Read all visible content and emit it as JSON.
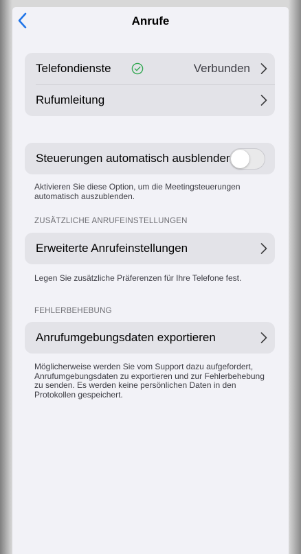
{
  "navbar": {
    "title": "Anrufe",
    "back_icon": "chevron-left-icon"
  },
  "phone_services": {
    "label": "Telefondienste",
    "status_icon": "check-circle-icon",
    "status": "Verbunden"
  },
  "call_forwarding": {
    "label": "Rufumleitung"
  },
  "auto_hide": {
    "label": "Steuerungen automatisch ausblenden",
    "enabled": false,
    "footnote": "Aktivieren Sie diese Option, um die Meetingsteuerungen automatisch auszublenden."
  },
  "additional_settings": {
    "header": "ZUSÄTZLICHE ANRUFEINSTELLUNGEN",
    "label": "Erweiterte Anrufeinstellungen",
    "footnote": "Legen Sie zusätzliche Präferenzen für Ihre Telefone fest."
  },
  "troubleshooting": {
    "header": "FEHLERBEHEBUNG",
    "label": "Anrufumgebungsdaten exportieren",
    "footnote": "Möglicherweise werden Sie vom Support dazu aufgefordert, Anrufumgebungsdaten zu exportieren und zur Fehlerbehebung zu senden. Es werden keine persönlichen Daten in den Protokollen gespeichert."
  },
  "colors": {
    "accent": "#1f74e8",
    "status_green": "#34a853",
    "group_background": "#e3e3e8",
    "screen_background": "#f2f2f7"
  }
}
